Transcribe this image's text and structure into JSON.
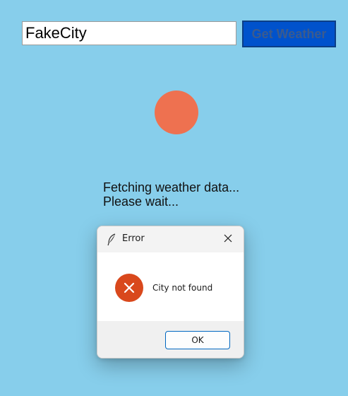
{
  "app": {
    "city_input_value": "FakeCity",
    "get_weather_label": "Get Weather",
    "status_text": "Fetching weather data...\nPlease wait...",
    "weather_icon": "circle-icon",
    "colors": {
      "background": "#87ceeb",
      "button": "#0052cc",
      "weather_icon": "#ee7150"
    }
  },
  "dialog": {
    "title": "Error",
    "title_icon": "feather-icon",
    "close_icon": "close-icon",
    "message": "City not found",
    "message_icon": "error-icon",
    "ok_label": "OK",
    "colors": {
      "error_icon": "#d9481c",
      "ok_border": "#0067c0"
    }
  }
}
